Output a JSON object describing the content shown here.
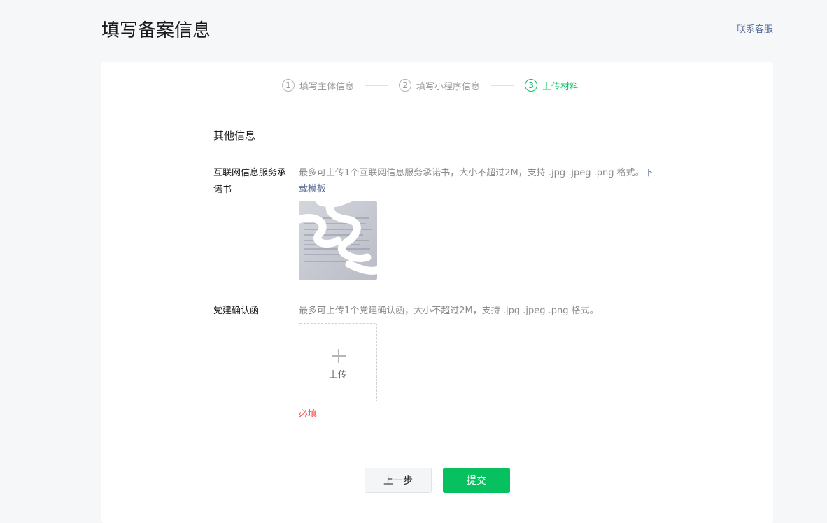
{
  "header": {
    "title": "填写备案信息",
    "contact_label": "联系客服"
  },
  "steps": [
    {
      "number": "1",
      "label": "填写主体信息",
      "state": "done"
    },
    {
      "number": "2",
      "label": "填写小程序信息",
      "state": "done"
    },
    {
      "number": "3",
      "label": "上传材料",
      "state": "active"
    }
  ],
  "form": {
    "section_title": "其他信息",
    "fields": [
      {
        "label": "互联网信息服务承诺书",
        "hint": "最多可上传1个互联网信息服务承诺书，大小不超过2M，支持 .jpg .jpeg .png 格式。",
        "link_text": "下载模板",
        "uploaded_count": 1
      },
      {
        "label": "党建确认函",
        "hint": "最多可上传1个党建确认函，大小不超过2M，支持 .jpg .jpeg .png 格式。",
        "upload_label": "上传",
        "error_text": "必填",
        "uploaded_count": 0
      }
    ]
  },
  "buttons": {
    "prev_label": "上一步",
    "submit_label": "提交"
  },
  "colors": {
    "accent": "#07c160",
    "link": "#576b95",
    "error": "#fa5151",
    "page_bg": "#f6f7f9",
    "card_bg": "#ffffff"
  },
  "icons": {
    "upload": "plus-icon",
    "document": "document-thumbnail"
  }
}
